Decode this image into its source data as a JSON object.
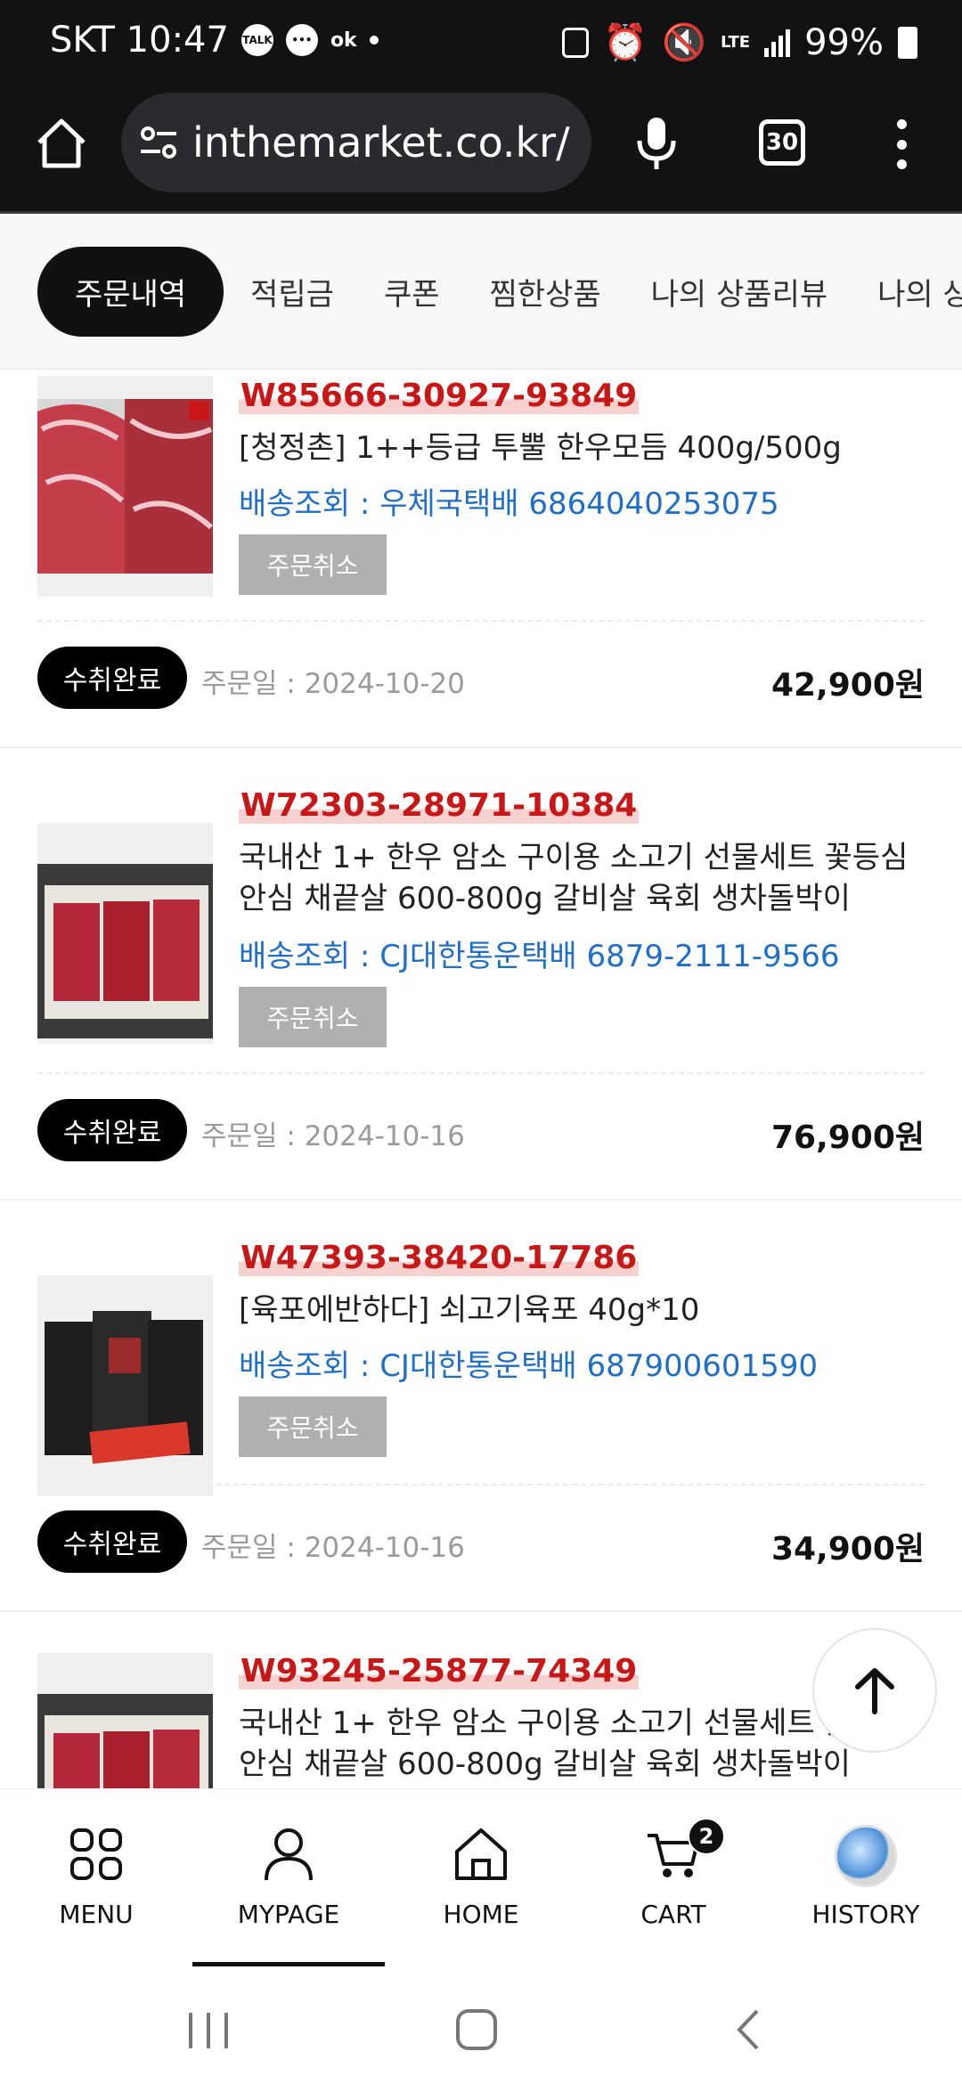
{
  "status_bar": {
    "carrier_time": "SKT 10:47",
    "icons": [
      "talk-icon",
      "chat-icon",
      "ok-icon",
      "dot-icon",
      "nfc-icon",
      "alarm-icon",
      "mute-icon",
      "lte-icon",
      "signal-icon",
      "battery-icon"
    ],
    "talk": "TALK",
    "ok": "ok",
    "lte": "LTE",
    "battery": "99%"
  },
  "browser": {
    "url": "inthemarket.co.kr/",
    "tab_count": "30"
  },
  "tabs": [
    {
      "label": "주문내역"
    },
    {
      "label": "적립금"
    },
    {
      "label": "쿠폰"
    },
    {
      "label": "찜한상품"
    },
    {
      "label": "나의 상품리뷰"
    },
    {
      "label": "나의 상품"
    }
  ],
  "orders": [
    {
      "order_no": "W85666-30927-93849",
      "name": "[청정촌] 1++등급 투뿔 한우모듬 400g/500g",
      "shipping": "배송조회 : 우체국택배 6864040253075",
      "cancel": "주문취소",
      "status": "수취완료",
      "date": "주문일 : 2024-10-20",
      "price": "42,900원"
    },
    {
      "order_no": "W72303-28971-10384",
      "name": "국내산 1+ 한우 암소 구이용 소고기 선물세트 꽃등심 안심 채끝살 600-800g 갈비살 육회 생차돌박이",
      "shipping": "배송조회 : CJ대한통운택배 6879-2111-9566",
      "cancel": "주문취소",
      "status": "수취완료",
      "date": "주문일 : 2024-10-16",
      "price": "76,900원"
    },
    {
      "order_no": "W47393-38420-17786",
      "name": "[육포에반하다] 쇠고기육포 40g*10",
      "shipping": "배송조회 : CJ대한통운택배 687900601590",
      "cancel": "주문취소",
      "status": "수취완료",
      "date": "주문일 : 2024-10-16",
      "price": "34,900원"
    },
    {
      "order_no": "W93245-25877-74349",
      "name": "국내산 1+ 한우 암소 구이용 소고기 선물세트 꽃등심 안심 채끝살 600-800g 갈비살 육회 생차돌박이"
    }
  ],
  "bottom_nav": [
    {
      "label": "MENU",
      "icon": "grid-icon"
    },
    {
      "label": "MYPAGE",
      "icon": "user-icon"
    },
    {
      "label": "HOME",
      "icon": "house-icon"
    },
    {
      "label": "CART",
      "icon": "cart-icon",
      "badge": "2"
    },
    {
      "label": "HISTORY",
      "icon": "history-thumbnail"
    }
  ],
  "colors": {
    "order_no": "#c81717",
    "shipping_link": "#1f6fc9",
    "status_badge": "#000000",
    "cancel_button": "#b0b0b0"
  }
}
